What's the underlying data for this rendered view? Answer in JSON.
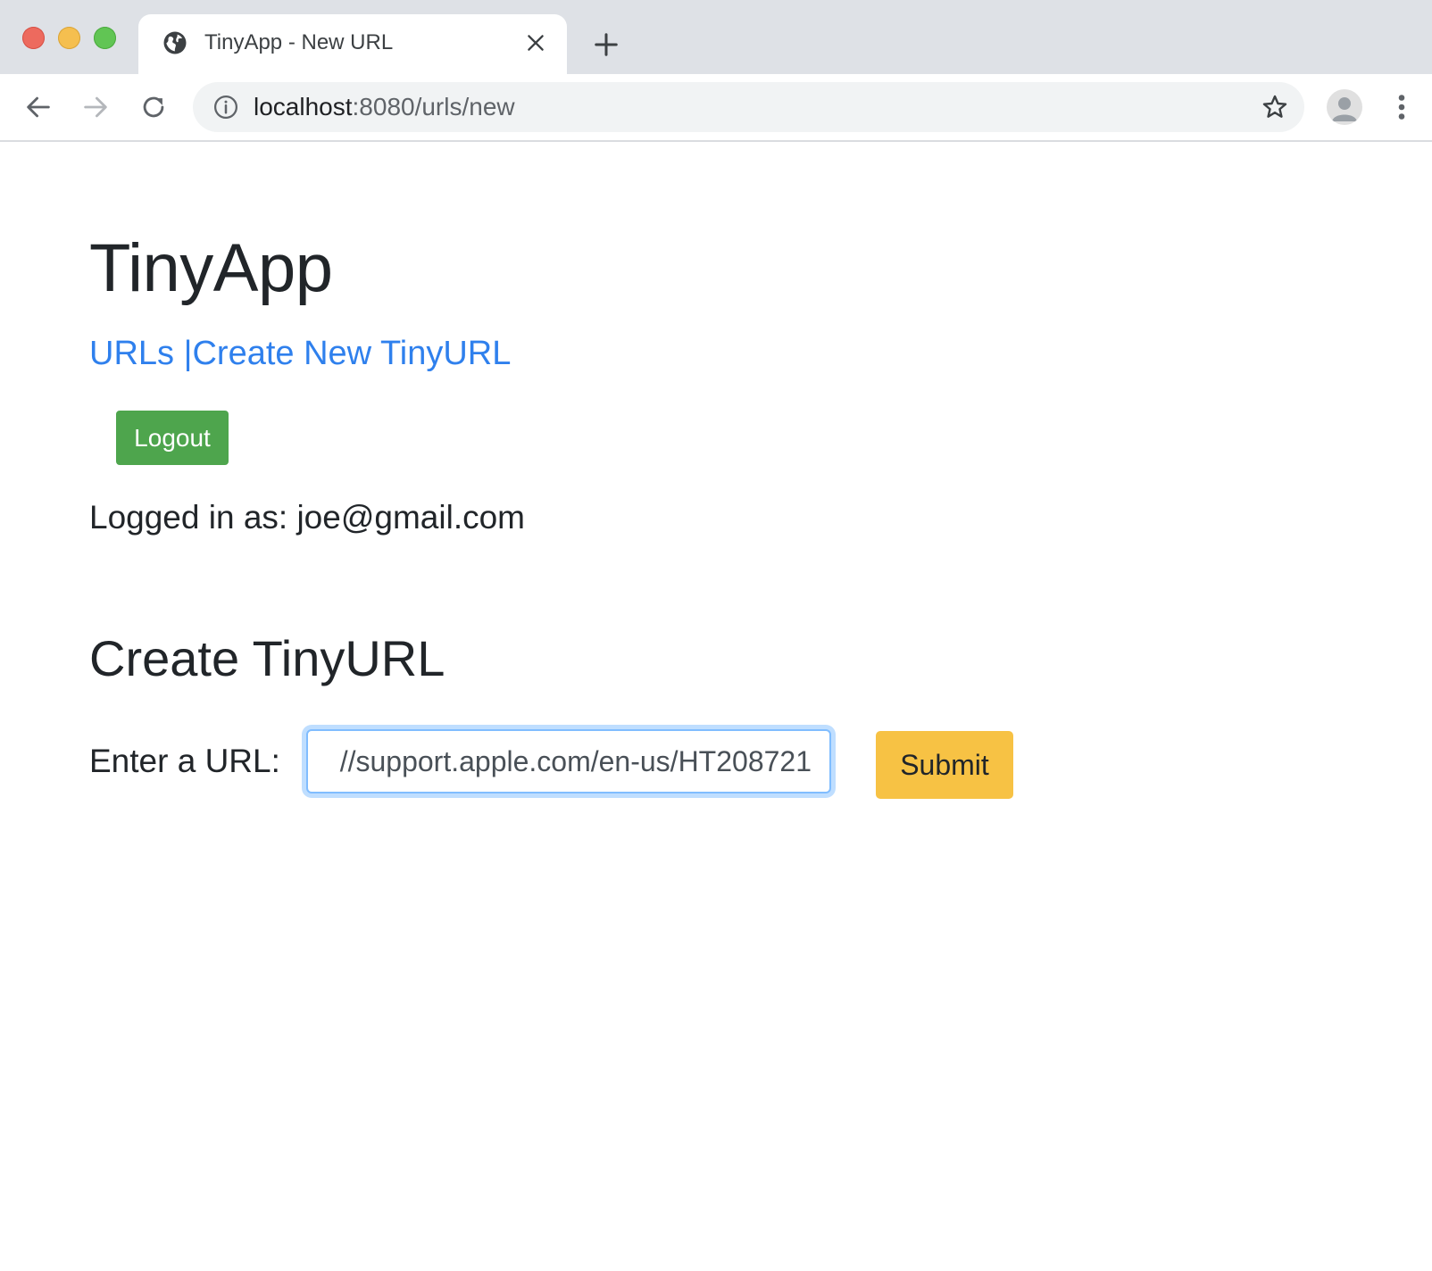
{
  "browser": {
    "tab": {
      "title": "TinyApp - New URL",
      "icon": "globe-icon"
    },
    "address": {
      "host": "localhost",
      "rest": ":8080/urls/new"
    }
  },
  "page": {
    "app_title": "TinyApp",
    "nav": {
      "urls_link": "URLs",
      "separator": " |",
      "create_link": "Create New TinyURL"
    },
    "logout_label": "Logout",
    "logged_in_text": "Logged in as: joe@gmail.com",
    "section_title": "Create TinyURL",
    "form": {
      "label": "Enter a URL:",
      "input_value": "//support.apple.com/en-us/HT208721",
      "submit_label": "Submit"
    }
  },
  "colors": {
    "tabbar": "#dee1e6",
    "link": "#2f80ed",
    "logout_button": "#4ea54d",
    "submit_button": "#f7c244",
    "input_focus_border": "#80bdff"
  }
}
